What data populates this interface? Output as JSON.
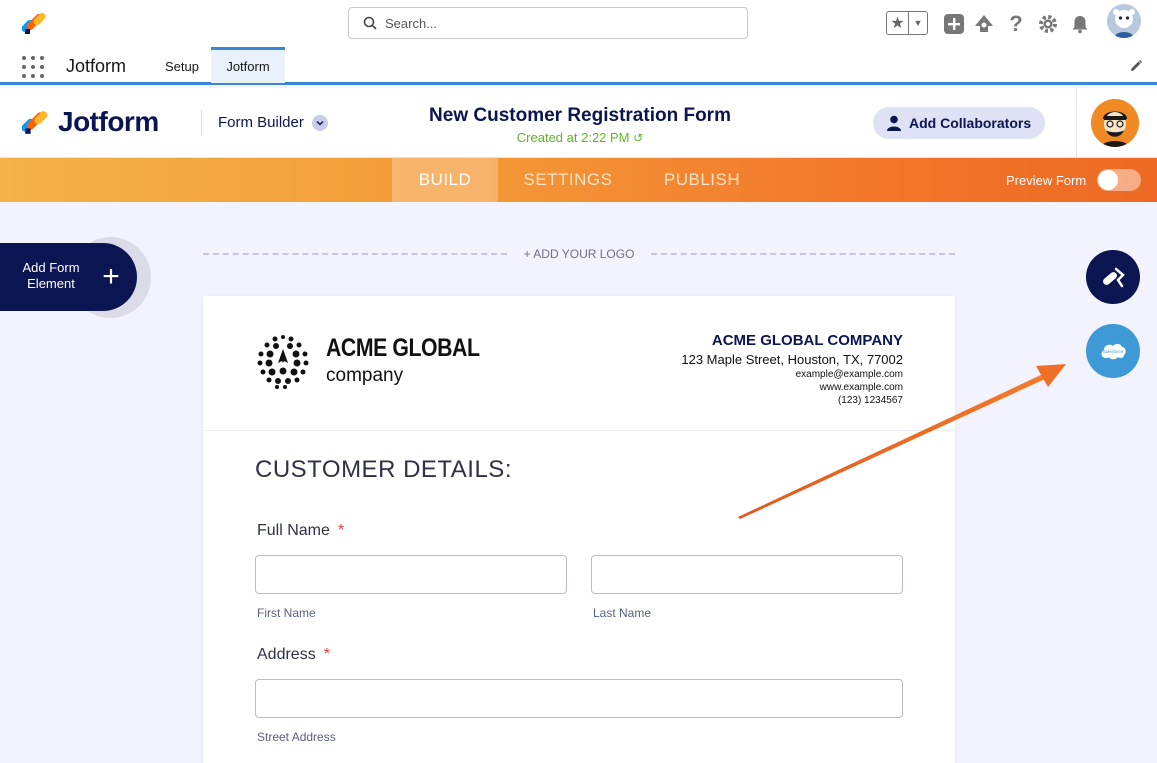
{
  "salesforce": {
    "search_placeholder": "Search...",
    "app_name": "Jotform",
    "nav_tabs": [
      "Setup",
      "Jotform"
    ]
  },
  "header": {
    "logo_text": "Jotform",
    "builder_label": "Form Builder",
    "form_title": "New Customer Registration Form",
    "created": "Created at 2:22 PM",
    "collab_label": "Add Collaborators"
  },
  "tabs": {
    "build": "BUILD",
    "settings": "SETTINGS",
    "publish": "PUBLISH",
    "active": "BUILD",
    "preview_label": "Preview Form",
    "preview_on": false
  },
  "canvas": {
    "add_element_line1": "Add Form",
    "add_element_line2": "Element",
    "add_logo": "+ ADD YOUR LOGO"
  },
  "company": {
    "logo_line1": "ACME GLOBAL",
    "logo_line2": "company",
    "name": "ACME GLOBAL COMPANY",
    "address": "123 Maple Street, Houston, TX, 77002",
    "email": "example@example.com",
    "website": "www.example.com",
    "phone": "(123) 1234567"
  },
  "form": {
    "section_title": "CUSTOMER DETAILS:",
    "full_name_label": "Full Name",
    "first_name_sub": "First Name",
    "last_name_sub": "Last Name",
    "address_label": "Address",
    "street_sub": "Street Address",
    "required_mark": "*"
  },
  "colors": {
    "navy": "#0a1551",
    "orange": "#f2762a",
    "salesforce_blue": "#3d9ad6",
    "created_green": "#64b22c",
    "arrow": "#ee6a24"
  }
}
